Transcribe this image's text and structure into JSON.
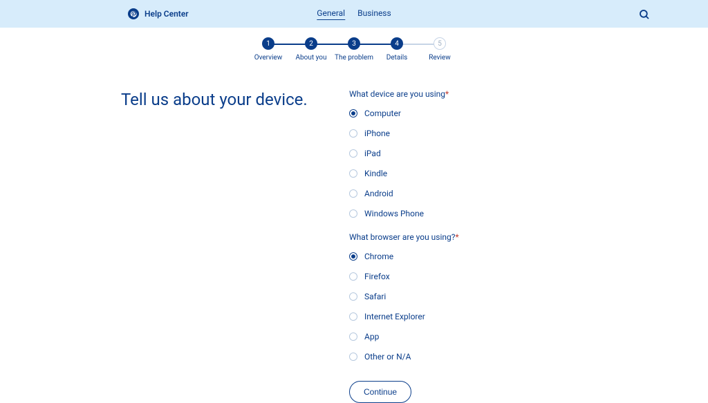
{
  "header": {
    "brand_label": "Help Center",
    "tabs": {
      "general": "General",
      "business": "Business"
    }
  },
  "stepper": {
    "steps": [
      {
        "num": "1",
        "label": "Overview"
      },
      {
        "num": "2",
        "label": "About you"
      },
      {
        "num": "3",
        "label": "The problem"
      },
      {
        "num": "4",
        "label": "Details"
      },
      {
        "num": "5",
        "label": "Review"
      }
    ]
  },
  "page": {
    "heading": "Tell us about your device."
  },
  "form": {
    "device_question": "What device are you using",
    "device_options": [
      "Computer",
      "iPhone",
      "iPad",
      "Kindle",
      "Android",
      "Windows Phone"
    ],
    "device_selected": "Computer",
    "browser_question": "What browser are you using?",
    "browser_options": [
      "Chrome",
      "Firefox",
      "Safari",
      "Internet Explorer",
      "App",
      "Other or N/A"
    ],
    "browser_selected": "Chrome",
    "continue_label": "Continue",
    "required_mark": "*"
  }
}
